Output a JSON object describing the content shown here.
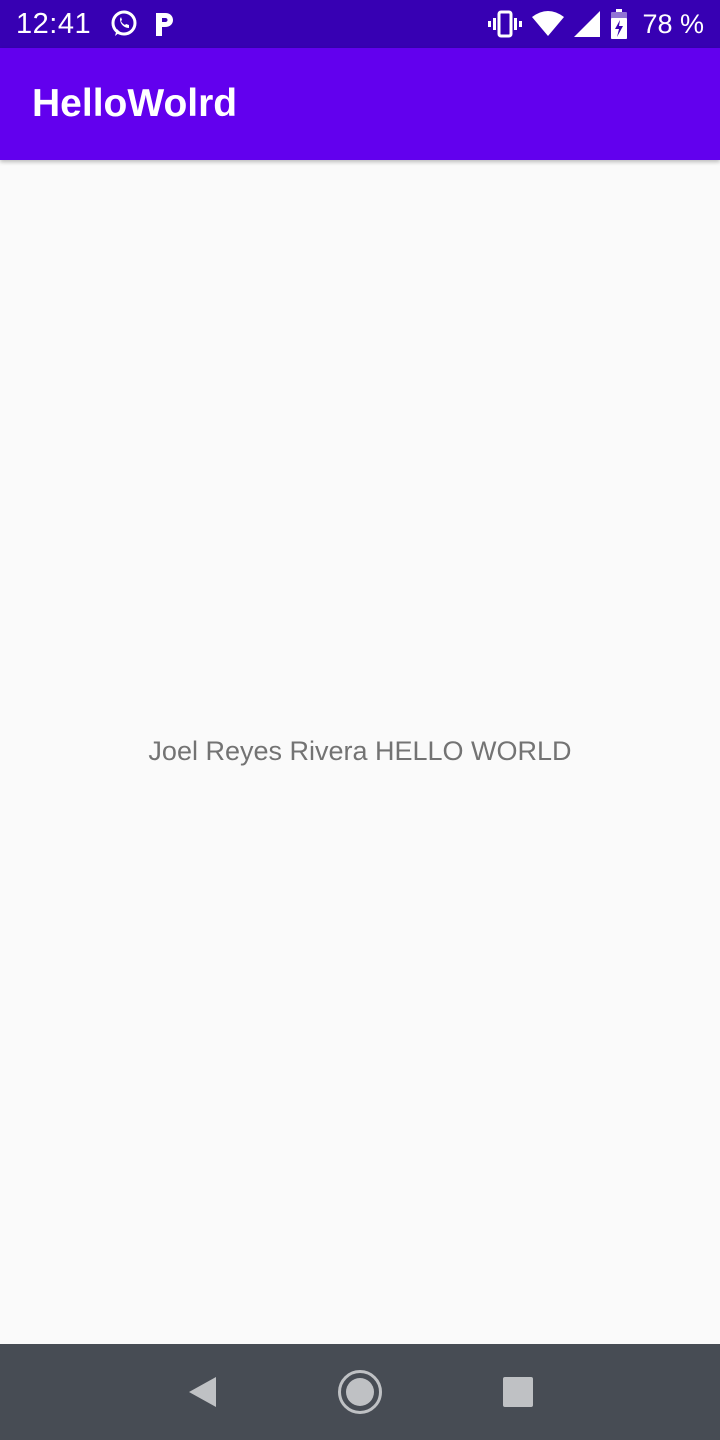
{
  "status_bar": {
    "time": "12:41",
    "left_icons": [
      "whatsapp-icon",
      "parking-icon"
    ],
    "right_icons": [
      "vibrate-icon",
      "wifi-icon",
      "signal-icon",
      "battery-charging-icon"
    ],
    "battery_percent": "78 %",
    "color": "#3700b3"
  },
  "app_bar": {
    "title": "HelloWolrd",
    "color": "#6200ee"
  },
  "content": {
    "message": "Joel Reyes Rivera HELLO WORLD",
    "text_color": "#737373",
    "background": "#fafafa"
  },
  "nav_bar": {
    "buttons": [
      "back-icon",
      "home-icon",
      "recents-icon"
    ],
    "color": "#474c54"
  }
}
